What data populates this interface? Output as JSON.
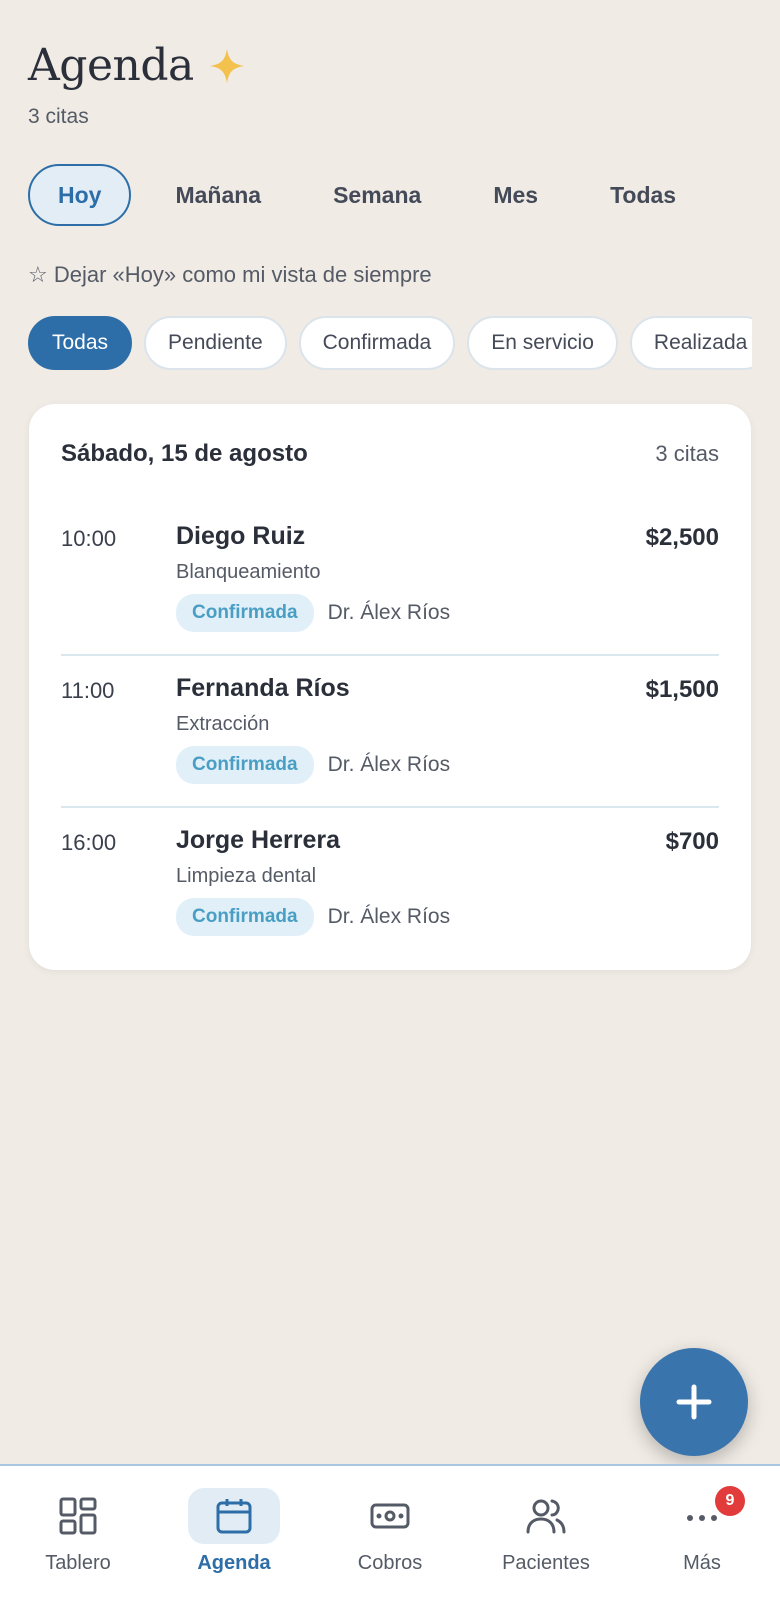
{
  "header": {
    "title": "Agenda",
    "count": "3 citas"
  },
  "range_tabs": [
    {
      "label": "Hoy",
      "active": true
    },
    {
      "label": "Mañana",
      "active": false
    },
    {
      "label": "Semana",
      "active": false
    },
    {
      "label": "Mes",
      "active": false
    },
    {
      "label": "Todas",
      "active": false
    }
  ],
  "default_view": {
    "icon": "star-outline-icon",
    "label": "☆ Dejar «Hoy» como mi vista de siempre"
  },
  "status_filters": [
    {
      "label": "Todas",
      "active": true
    },
    {
      "label": "Pendiente",
      "active": false
    },
    {
      "label": "Confirmada",
      "active": false
    },
    {
      "label": "En servicio",
      "active": false
    },
    {
      "label": "Realizada",
      "active": false
    }
  ],
  "day": {
    "title": "Sábado, 15 de agosto",
    "count": "3 citas",
    "appointments": [
      {
        "time": "10:00",
        "patient": "Diego Ruiz",
        "service": "Blanqueamiento",
        "status": "Confirmada",
        "doctor": "Dr. Álex Ríos",
        "price": "$2,500"
      },
      {
        "time": "11:00",
        "patient": "Fernanda Ríos",
        "service": "Extracción",
        "status": "Confirmada",
        "doctor": "Dr. Álex Ríos",
        "price": "$1,500"
      },
      {
        "time": "16:00",
        "patient": "Jorge Herrera",
        "service": "Limpieza dental",
        "status": "Confirmada",
        "doctor": "Dr. Álex Ríos",
        "price": "$700"
      }
    ]
  },
  "nav": [
    {
      "label": "Tablero",
      "icon": "dashboard-icon",
      "active": false
    },
    {
      "label": "Agenda",
      "icon": "calendar-icon",
      "active": true
    },
    {
      "label": "Cobros",
      "icon": "cash-icon",
      "active": false
    },
    {
      "label": "Pacientes",
      "icon": "users-icon",
      "active": false
    },
    {
      "label": "Más",
      "icon": "more-icon",
      "active": false,
      "badge": "9"
    }
  ],
  "colors": {
    "accent": "#2e6ea8",
    "background": "#f0ebe5",
    "badge_text": "#4a9ec4",
    "notification": "#e23b3b",
    "sparkle": "#f2c14e"
  }
}
